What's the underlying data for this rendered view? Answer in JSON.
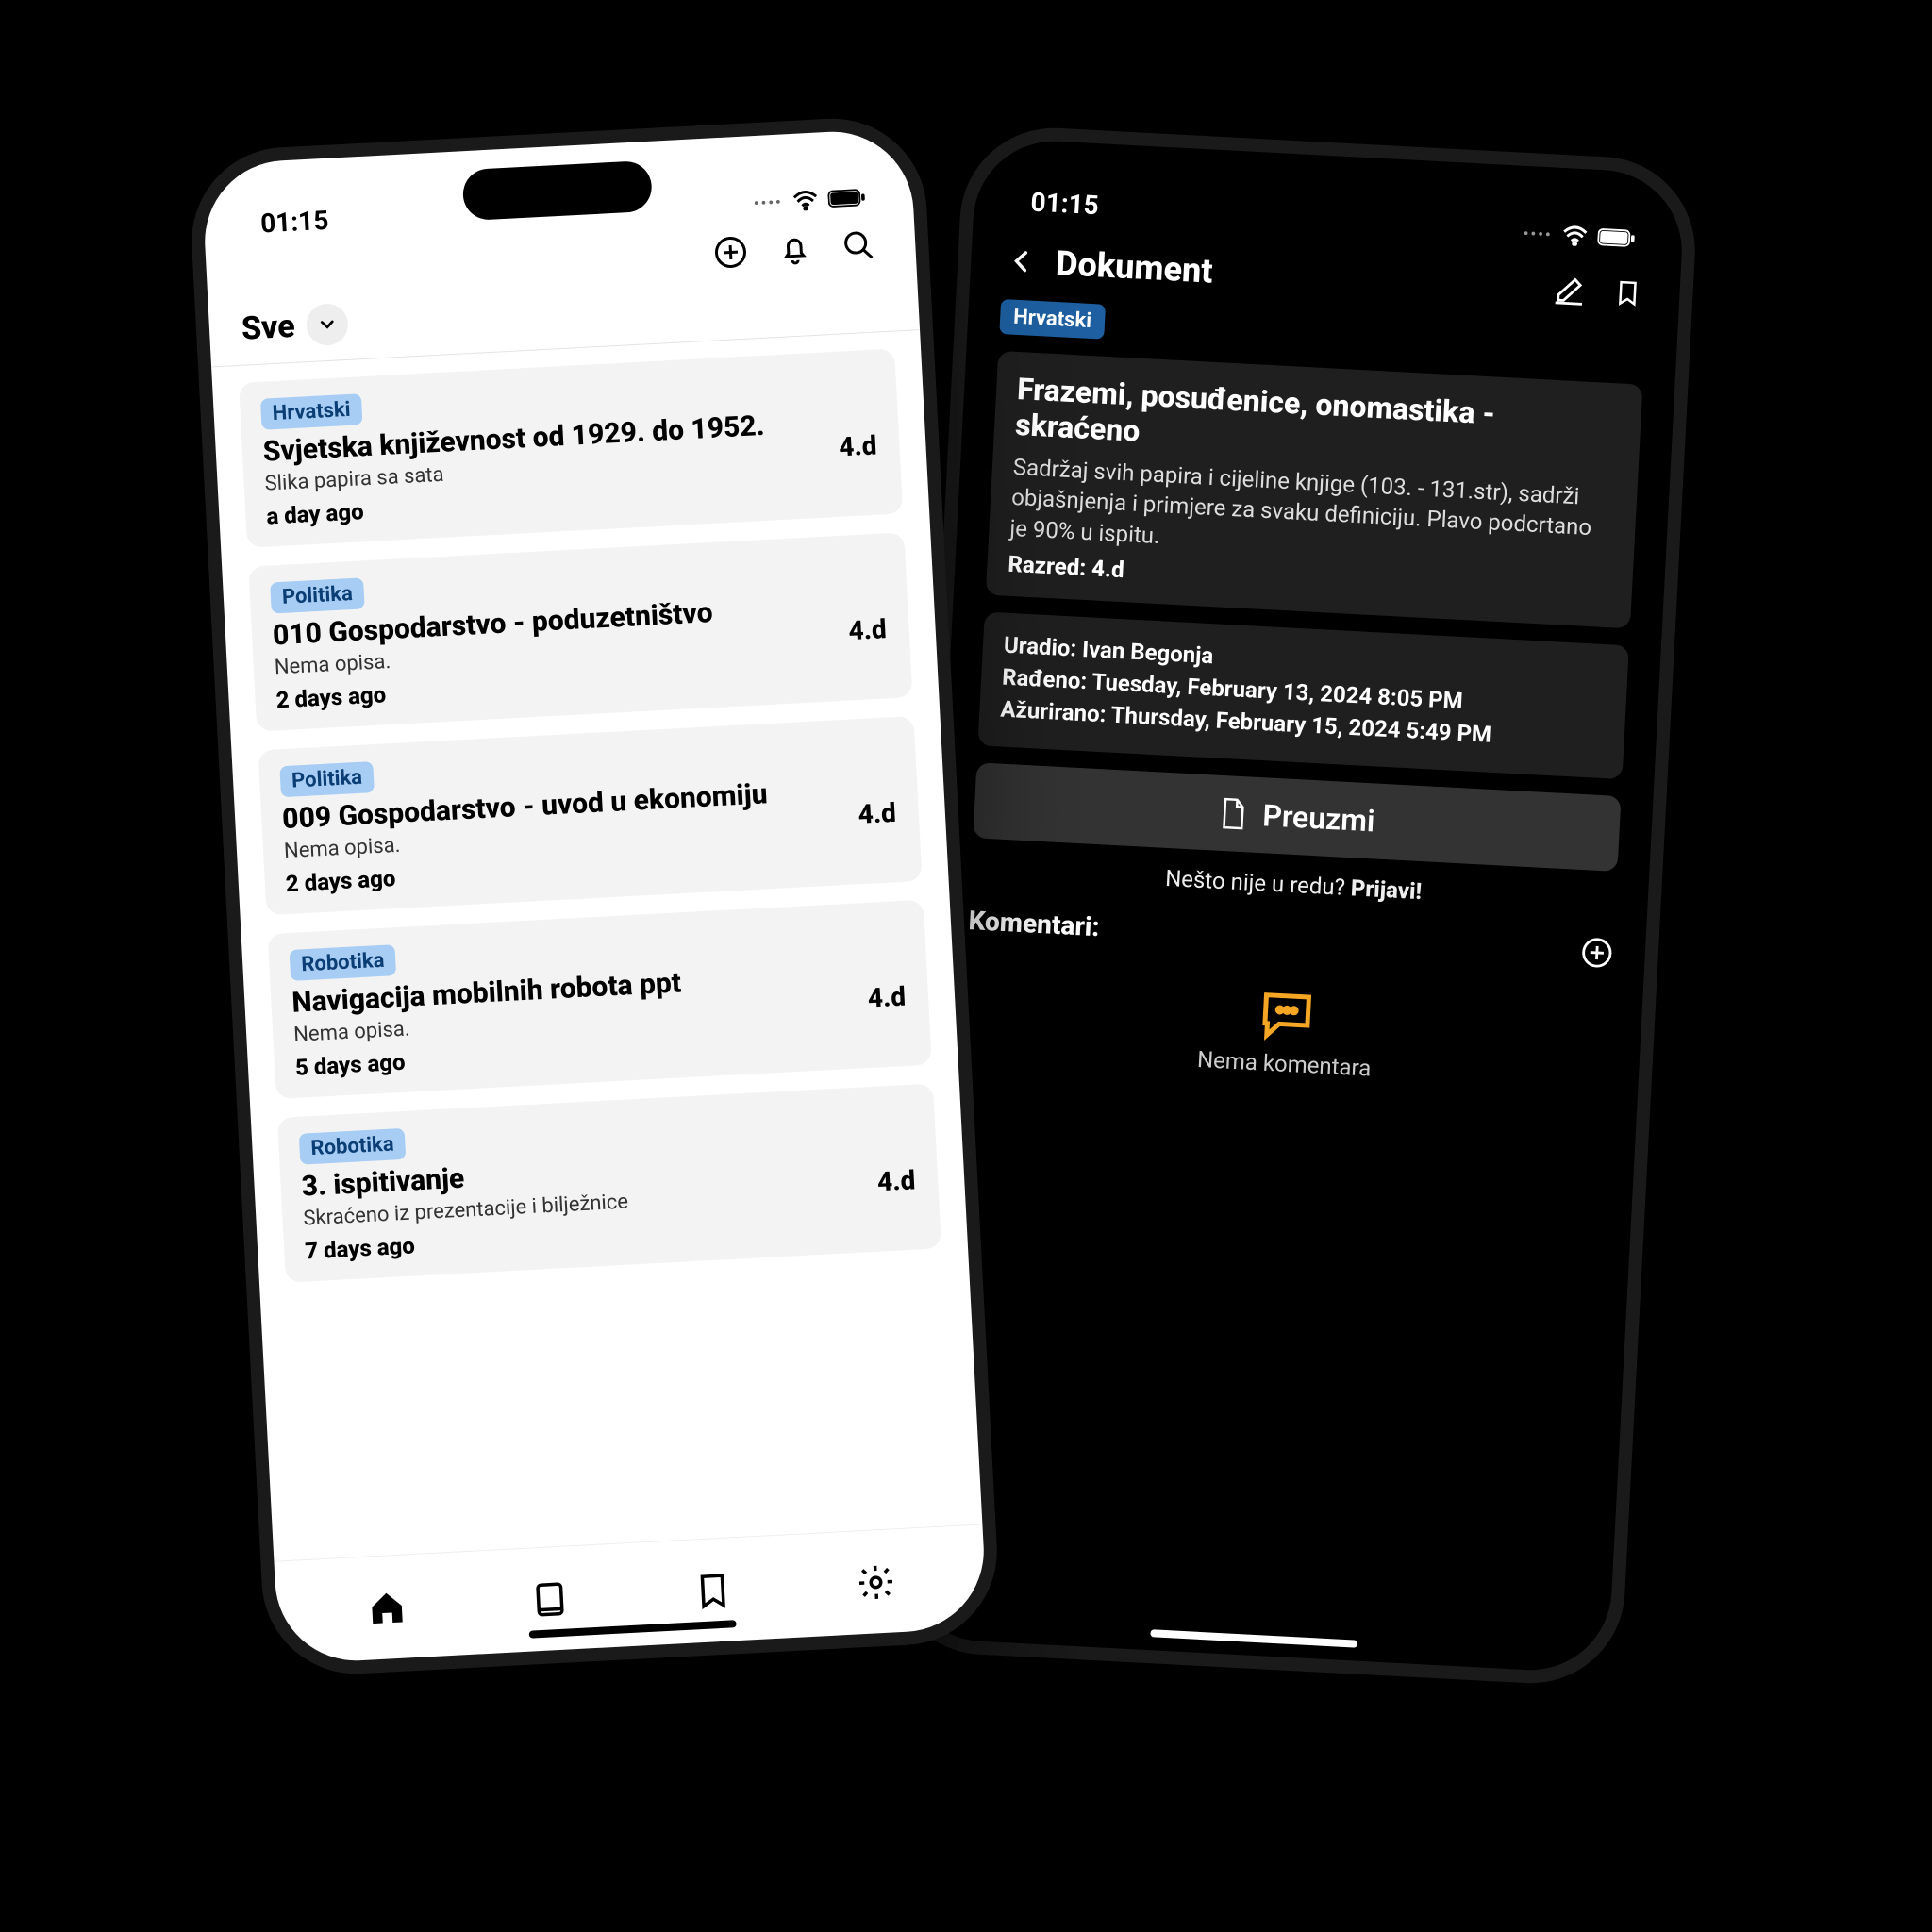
{
  "status": {
    "time": "01:15"
  },
  "light": {
    "filter_label": "Sve",
    "cards": [
      {
        "tag": "Hrvatski",
        "title": "Svjetska književnost od 1929. do 1952.",
        "desc": "Slika papira sa sata",
        "time": "a day ago",
        "grade": "4.d"
      },
      {
        "tag": "Politika",
        "title": "010 Gospodarstvo - poduzetništvo",
        "desc": "Nema opisa.",
        "time": "2 days ago",
        "grade": "4.d"
      },
      {
        "tag": "Politika",
        "title": "009 Gospodarstvo - uvod u ekonomiju",
        "desc": "Nema opisa.",
        "time": "2 days ago",
        "grade": "4.d"
      },
      {
        "tag": "Robotika",
        "title": "Navigacija mobilnih robota ppt",
        "desc": "Nema opisa.",
        "time": "5 days ago",
        "grade": "4.d"
      },
      {
        "tag": "Robotika",
        "title": "3. ispitivanje",
        "desc": "Skraćeno iz prezentacije i bilježnice",
        "time": "7 days ago",
        "grade": "4.d"
      }
    ]
  },
  "dark": {
    "header_title": "Dokument",
    "tag": "Hrvatski",
    "doc_title": "Frazemi, posuđenice, onomastika - skraćeno",
    "doc_desc": "Sadržaj svih papira i cijeline knjige (103. - 131.str), sadrži objašnjenja i primjere za svaku definiciju. Plavo podcrtano je 90% u ispitu.",
    "grade_line": "Razred: 4.d",
    "author_line": "Uradio: Ivan Begonja",
    "created_line": "Rađeno: Tuesday, February 13, 2024 8:05 PM",
    "edited_line": "Ažurirano: Thursday, February 15, 2024 5:49 PM",
    "download_label": "Preuzmi",
    "report_prefix": "Nešto nije u redu? ",
    "report_action": "Prijavi!",
    "comments_label": "Komentari:",
    "no_comments": "Nema komentara"
  }
}
